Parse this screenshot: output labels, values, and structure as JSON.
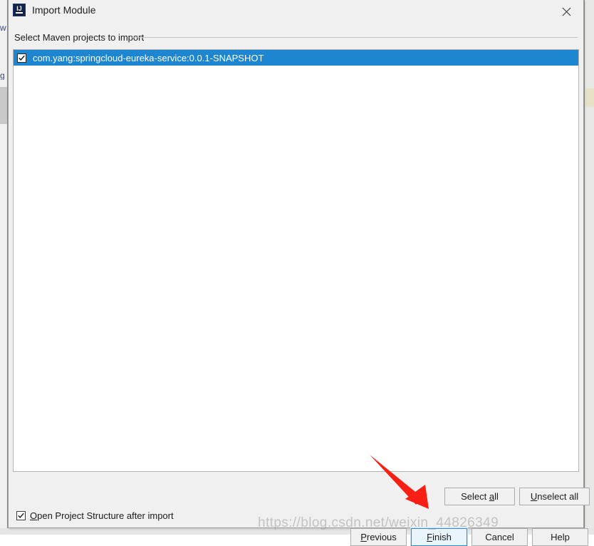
{
  "window": {
    "title": "Import Module",
    "icon": "intellij-idea-logo",
    "icon_letters": "IJ",
    "close_icon": "close-icon"
  },
  "section": {
    "label": "Select Maven projects to import"
  },
  "list": {
    "items": [
      {
        "label": "com.yang:springcloud-eureka-service:0.0.1-SNAPSHOT",
        "checked": true,
        "selected": true
      }
    ]
  },
  "selection_buttons": {
    "select_all": {
      "pre": "Select ",
      "mnemonic": "a",
      "post": "ll"
    },
    "unselect_all": {
      "pre": "",
      "mnemonic": "U",
      "post": "nselect all"
    }
  },
  "options": {
    "open_project_structure": {
      "pre": "",
      "mnemonic": "O",
      "post": "pen Project Structure after import",
      "checked": true
    }
  },
  "dialog_buttons": {
    "previous": {
      "pre": "",
      "mnemonic": "P",
      "post": "revious",
      "default": false
    },
    "finish": {
      "pre": "",
      "mnemonic": "F",
      "post": "inish",
      "default": true
    },
    "cancel": {
      "pre": "Cancel",
      "mnemonic": "",
      "post": "",
      "default": false
    },
    "help": {
      "pre": "Help",
      "mnemonic": "",
      "post": "",
      "default": false
    }
  },
  "annotation": {
    "arrow_color": "#f81f14",
    "description": "red arrow pointing at Finish button"
  },
  "watermark": {
    "text": "https://blog.csdn.net/weixin_44826349"
  },
  "background": {
    "left_fragment_top": "w",
    "left_fragment_bottom": "g"
  },
  "colors": {
    "selection_blue": "#1e86d0",
    "default_button_border": "#2d8ad6",
    "dialog_bg": "#f0f0f0",
    "list_bg": "#ffffff",
    "arrow_red": "#f81f14"
  }
}
